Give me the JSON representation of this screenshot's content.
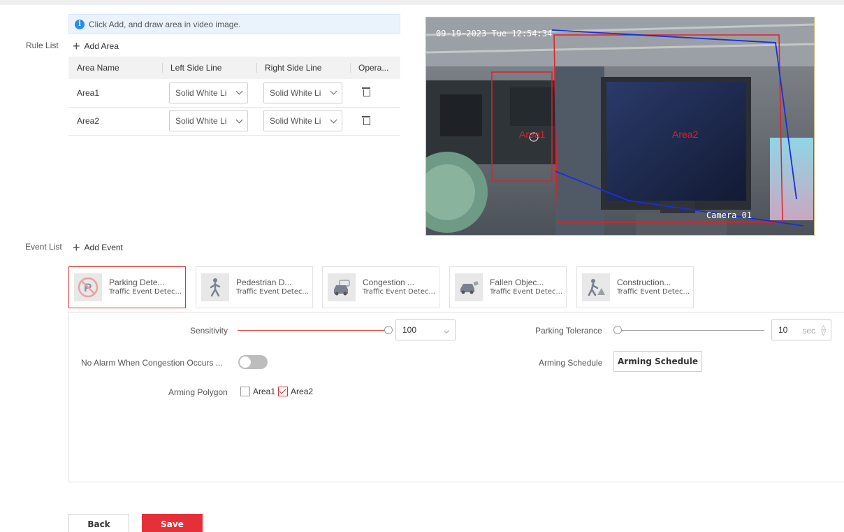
{
  "info": {
    "text": "Click Add, and draw area in video image."
  },
  "rule_list": {
    "label": "Rule List",
    "add_label": "Add Area",
    "columns": [
      "Area Name",
      "Left Side Line",
      "Right Side Line",
      "Opera..."
    ],
    "rows": [
      {
        "name": "Area1",
        "left": "Solid White Li",
        "right": "Solid White Li"
      },
      {
        "name": "Area2",
        "left": "Solid White Li",
        "right": "Solid White Li"
      }
    ]
  },
  "video": {
    "timestamp": "09-19-2023 Tue 12:54:34",
    "camera": "Camera 01",
    "area1_label": "Area1",
    "area2_label": "Area2",
    "colors": {
      "area": "#e0202a",
      "line": "#1a2fd6"
    }
  },
  "event_list": {
    "label": "Event List",
    "add_label": "Add Event",
    "events": [
      {
        "title": "Parking Dete...",
        "sub": "Traffic Event Detec...",
        "icon": "no-parking-icon",
        "active": true
      },
      {
        "title": "Pedestrian D...",
        "sub": "Traffic Event Detec...",
        "icon": "pedestrian-icon",
        "active": false
      },
      {
        "title": "Congestion ...",
        "sub": "Traffic Event Detec...",
        "icon": "congestion-icon",
        "active": false
      },
      {
        "title": "Fallen Objec...",
        "sub": "Traffic Event Detec...",
        "icon": "fallen-object-icon",
        "active": false
      },
      {
        "title": "Construction...",
        "sub": "Traffic Event Detec...",
        "icon": "construction-icon",
        "active": false
      }
    ]
  },
  "config": {
    "sensitivity_label": "Sensitivity",
    "sensitivity_value": "100",
    "parking_tolerance_label": "Parking Tolerance",
    "parking_tolerance_value": "10",
    "parking_tolerance_unit": "sec",
    "no_alarm_label": "No Alarm When Congestion Occurs ...",
    "no_alarm_on": false,
    "arming_schedule_label": "Arming Schedule",
    "arming_schedule_button": "Arming Schedule",
    "arming_polygon_label": "Arming Polygon",
    "polygons": [
      {
        "label": "Area1",
        "checked": false
      },
      {
        "label": "Area2",
        "checked": true
      }
    ]
  },
  "footer": {
    "back_label": "Back",
    "save_label": "Save"
  },
  "accent_color": "#e5303a"
}
